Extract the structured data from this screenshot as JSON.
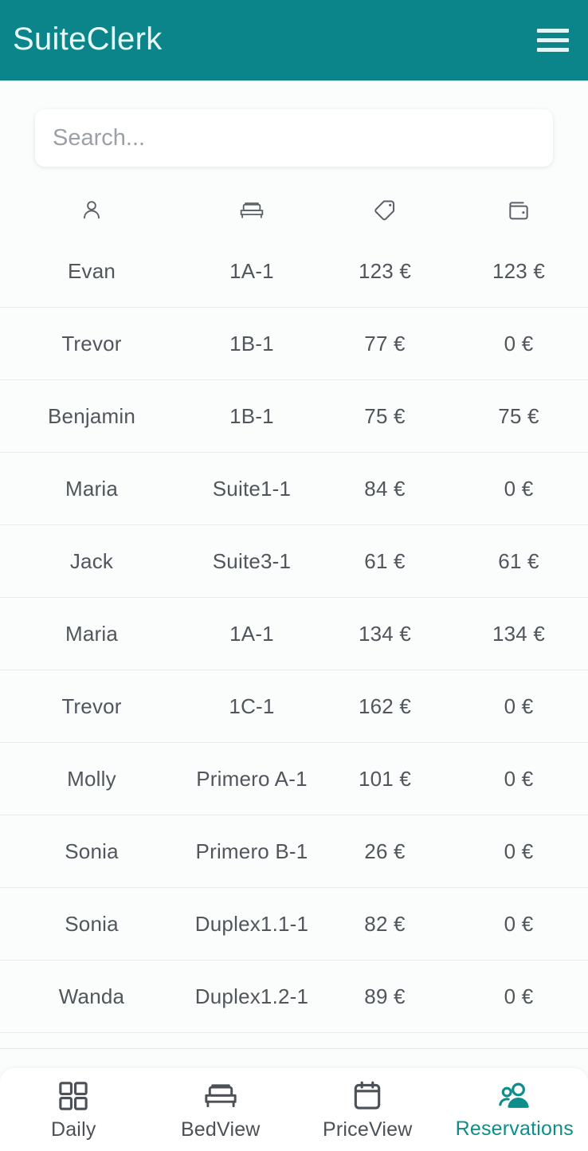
{
  "app": {
    "title": "SuiteClerk",
    "menu_icon": "hamburger-menu-icon",
    "header_bg": "#0b8589",
    "accent": "#0e8e8a"
  },
  "search": {
    "placeholder": "Search...",
    "value": ""
  },
  "table": {
    "columns": [
      {
        "key": "name",
        "icon": "person-icon"
      },
      {
        "key": "room",
        "icon": "bed-icon"
      },
      {
        "key": "price",
        "icon": "price-tag-icon"
      },
      {
        "key": "paid",
        "icon": "wallet-icon"
      }
    ],
    "rows": [
      {
        "name": "Evan",
        "room": "1A-1",
        "price": "123 €",
        "paid": "123 €"
      },
      {
        "name": "Trevor",
        "room": "1B-1",
        "price": "77 €",
        "paid": "0 €"
      },
      {
        "name": "Benjamin",
        "room": "1B-1",
        "price": "75 €",
        "paid": "75 €"
      },
      {
        "name": "Maria",
        "room": "Suite1-1",
        "price": "84 €",
        "paid": "0 €"
      },
      {
        "name": "Jack",
        "room": "Suite3-1",
        "price": "61 €",
        "paid": "61 €"
      },
      {
        "name": "Maria",
        "room": "1A-1",
        "price": "134 €",
        "paid": "134 €"
      },
      {
        "name": "Trevor",
        "room": "1C-1",
        "price": "162 €",
        "paid": "0 €"
      },
      {
        "name": "Molly",
        "room": "Primero A-1",
        "price": "101 €",
        "paid": "0 €"
      },
      {
        "name": "Sonia",
        "room": "Primero B-1",
        "price": "26 €",
        "paid": "0 €"
      },
      {
        "name": "Sonia",
        "room": "Duplex1.1-1",
        "price": "82 €",
        "paid": "0 €"
      },
      {
        "name": "Wanda",
        "room": "Duplex1.2-1",
        "price": "89 €",
        "paid": "0 €"
      }
    ]
  },
  "bottom_nav": {
    "items": [
      {
        "label": "Daily",
        "icon": "grid-icon",
        "active": false
      },
      {
        "label": "BedView",
        "icon": "bed-icon",
        "active": false
      },
      {
        "label": "PriceView",
        "icon": "calendar-icon",
        "active": false
      },
      {
        "label": "Reservations",
        "icon": "people-icon",
        "active": true
      }
    ]
  }
}
